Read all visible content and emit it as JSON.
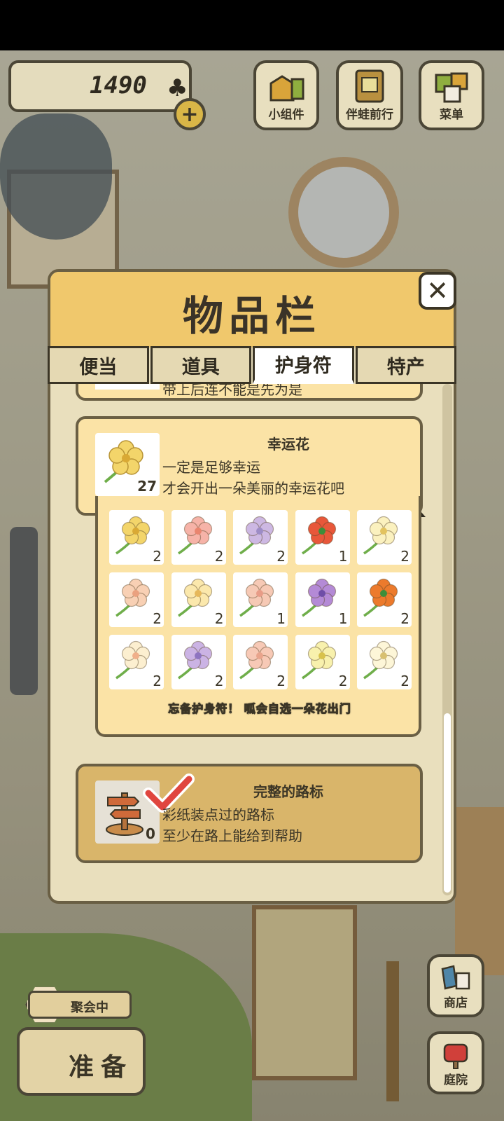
{
  "hud": {
    "clover_count": "1490",
    "clover_icon": "clover-icon",
    "plus_label": "+",
    "buttons": [
      {
        "label": "小组件",
        "icon": "widget-icon"
      },
      {
        "label": "伴蛙前行",
        "icon": "frog-journey-icon"
      },
      {
        "label": "菜单",
        "icon": "menu-icon"
      }
    ]
  },
  "panel": {
    "title": "物品栏",
    "close_label": "✕",
    "tabs": [
      {
        "label": "便当",
        "active": false
      },
      {
        "label": "道具",
        "active": false
      },
      {
        "label": "护身符",
        "active": true
      },
      {
        "label": "特产",
        "active": false
      }
    ],
    "partial_card_text": "带上后连不能是先为是",
    "lucky_flower": {
      "name": "幸运花",
      "count": "27",
      "desc_line1": "一定是足够幸运",
      "desc_line2": "才会开出一朵美丽的幸运花吧",
      "grid_hint": "忘备护身符！ 呱会自选一朵花出门",
      "flowers": [
        {
          "color": "#f3d56a",
          "center": "#d9a935",
          "count": "2"
        },
        {
          "color": "#f6b3a8",
          "center": "#e9856f",
          "count": "2"
        },
        {
          "color": "#cdb8e3",
          "center": "#9d8cc6",
          "count": "2"
        },
        {
          "color": "#e8573a",
          "center": "#3d8e3a",
          "count": "1"
        },
        {
          "color": "#fbf1bf",
          "center": "#e3c35f",
          "count": "2"
        },
        {
          "color": "#f8d0b4",
          "center": "#eaa17f",
          "count": "2"
        },
        {
          "color": "#fbe8ac",
          "center": "#e6b85a",
          "count": "2"
        },
        {
          "color": "#f6c9b5",
          "center": "#e89c87",
          "count": "1"
        },
        {
          "color": "#b48ad6",
          "center": "#6f4ea8",
          "count": "1"
        },
        {
          "color": "#ec7a2c",
          "center": "#3d8e3a",
          "count": "2"
        },
        {
          "color": "#fcefd0",
          "center": "#f0b08b",
          "count": "2"
        },
        {
          "color": "#cbb3e4",
          "center": "#8e74c0",
          "count": "2"
        },
        {
          "color": "#f7c9b6",
          "center": "#e9a48c",
          "count": "2"
        },
        {
          "color": "#f8f1ad",
          "center": "#d8c24c",
          "count": "2"
        },
        {
          "color": "#fdf6d8",
          "center": "#d8c070",
          "count": "2"
        }
      ]
    },
    "signpost": {
      "name": "完整的路标",
      "count": "0",
      "desc_line1": "彩纸装点过的路标",
      "desc_line2": "至少在路上能给到帮助",
      "selected": true
    }
  },
  "bottom": {
    "gathering_label": "聚会中",
    "prepare_label": "准备",
    "shop_label": "商店",
    "yard_label": "庭院"
  },
  "colors": {
    "panel_header": "#f0c86c",
    "card_bg": "#fbe3a6",
    "outline": "#3b3526",
    "check": "#e0463f"
  }
}
